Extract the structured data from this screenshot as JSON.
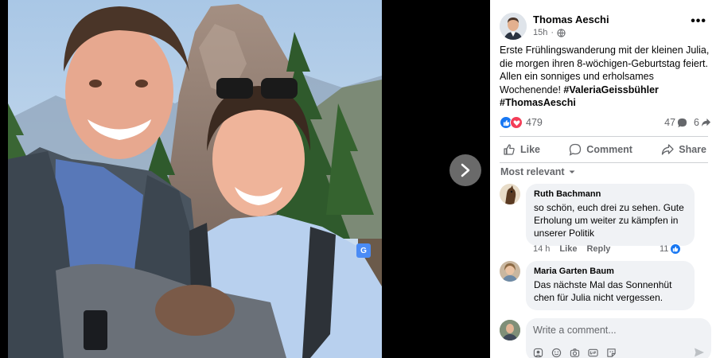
{
  "post": {
    "author": "Thomas Aeschi",
    "time": "15h",
    "more_label": "•••",
    "text": "Erste Frühlingswanderung mit der kleinen Julia, die morgen ihren 8-wöchigen-Geburtstag feiert. Allen ein sonniges und erholsames Wochenende!",
    "hashtags": "#ValeriaGeissbühler #ThomasAeschi"
  },
  "reactions": {
    "count": "479",
    "comments": "47",
    "shares": "6"
  },
  "actions": {
    "like": "Like",
    "comment": "Comment",
    "share": "Share"
  },
  "sort": {
    "label": "Most relevant"
  },
  "comments": [
    {
      "name": "Ruth Bachmann",
      "text": "so schön, euch drei zu sehen. Gute Erholung um weiter zu kämpfen in unserer Politik",
      "time": "14 h",
      "like": "Like",
      "reply": "Reply",
      "likes": "11"
    },
    {
      "name": "Maria Garten Baum",
      "text": "Das nächste Mal das Sonnenhüt chen für Julia nicht vergessen.",
      "time": "",
      "like": "",
      "reply": "",
      "likes": ""
    }
  ],
  "composer": {
    "placeholder": "Write a comment..."
  },
  "translate_badge": "G",
  "icons": {
    "next": "chevron-right-icon",
    "audience": "globe-icon",
    "send": "send-icon"
  },
  "colors": {
    "accent": "#1877f2",
    "love": "#f33e58",
    "muted": "#65676b",
    "bubble": "#f0f2f5"
  }
}
